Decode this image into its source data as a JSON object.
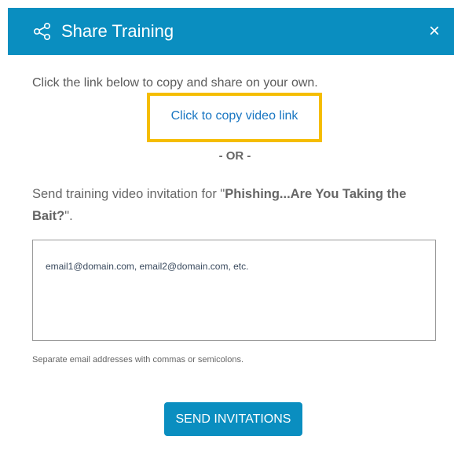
{
  "header": {
    "title": "Share Training",
    "share_icon": "share-icon",
    "close_label": "×",
    "close_icon": "close-icon",
    "background_color": "#0a8ec0"
  },
  "body": {
    "intro_text": "Click the link below to copy and share on your own.",
    "copy_link_label": "Click to copy video link",
    "highlight_color": "#f5bd00",
    "or_divider": "- OR -",
    "invite_prefix": "Send training video invitation for \"",
    "training_name": "Phishing...Are You Taking the Bait?",
    "invite_suffix": "\"."
  },
  "form": {
    "email_placeholder": "email1@domain.com, email2@domain.com, etc.",
    "email_value": "",
    "hint": "Separate email addresses with commas or semicolons.",
    "submit_label": "SEND INVITATIONS"
  }
}
